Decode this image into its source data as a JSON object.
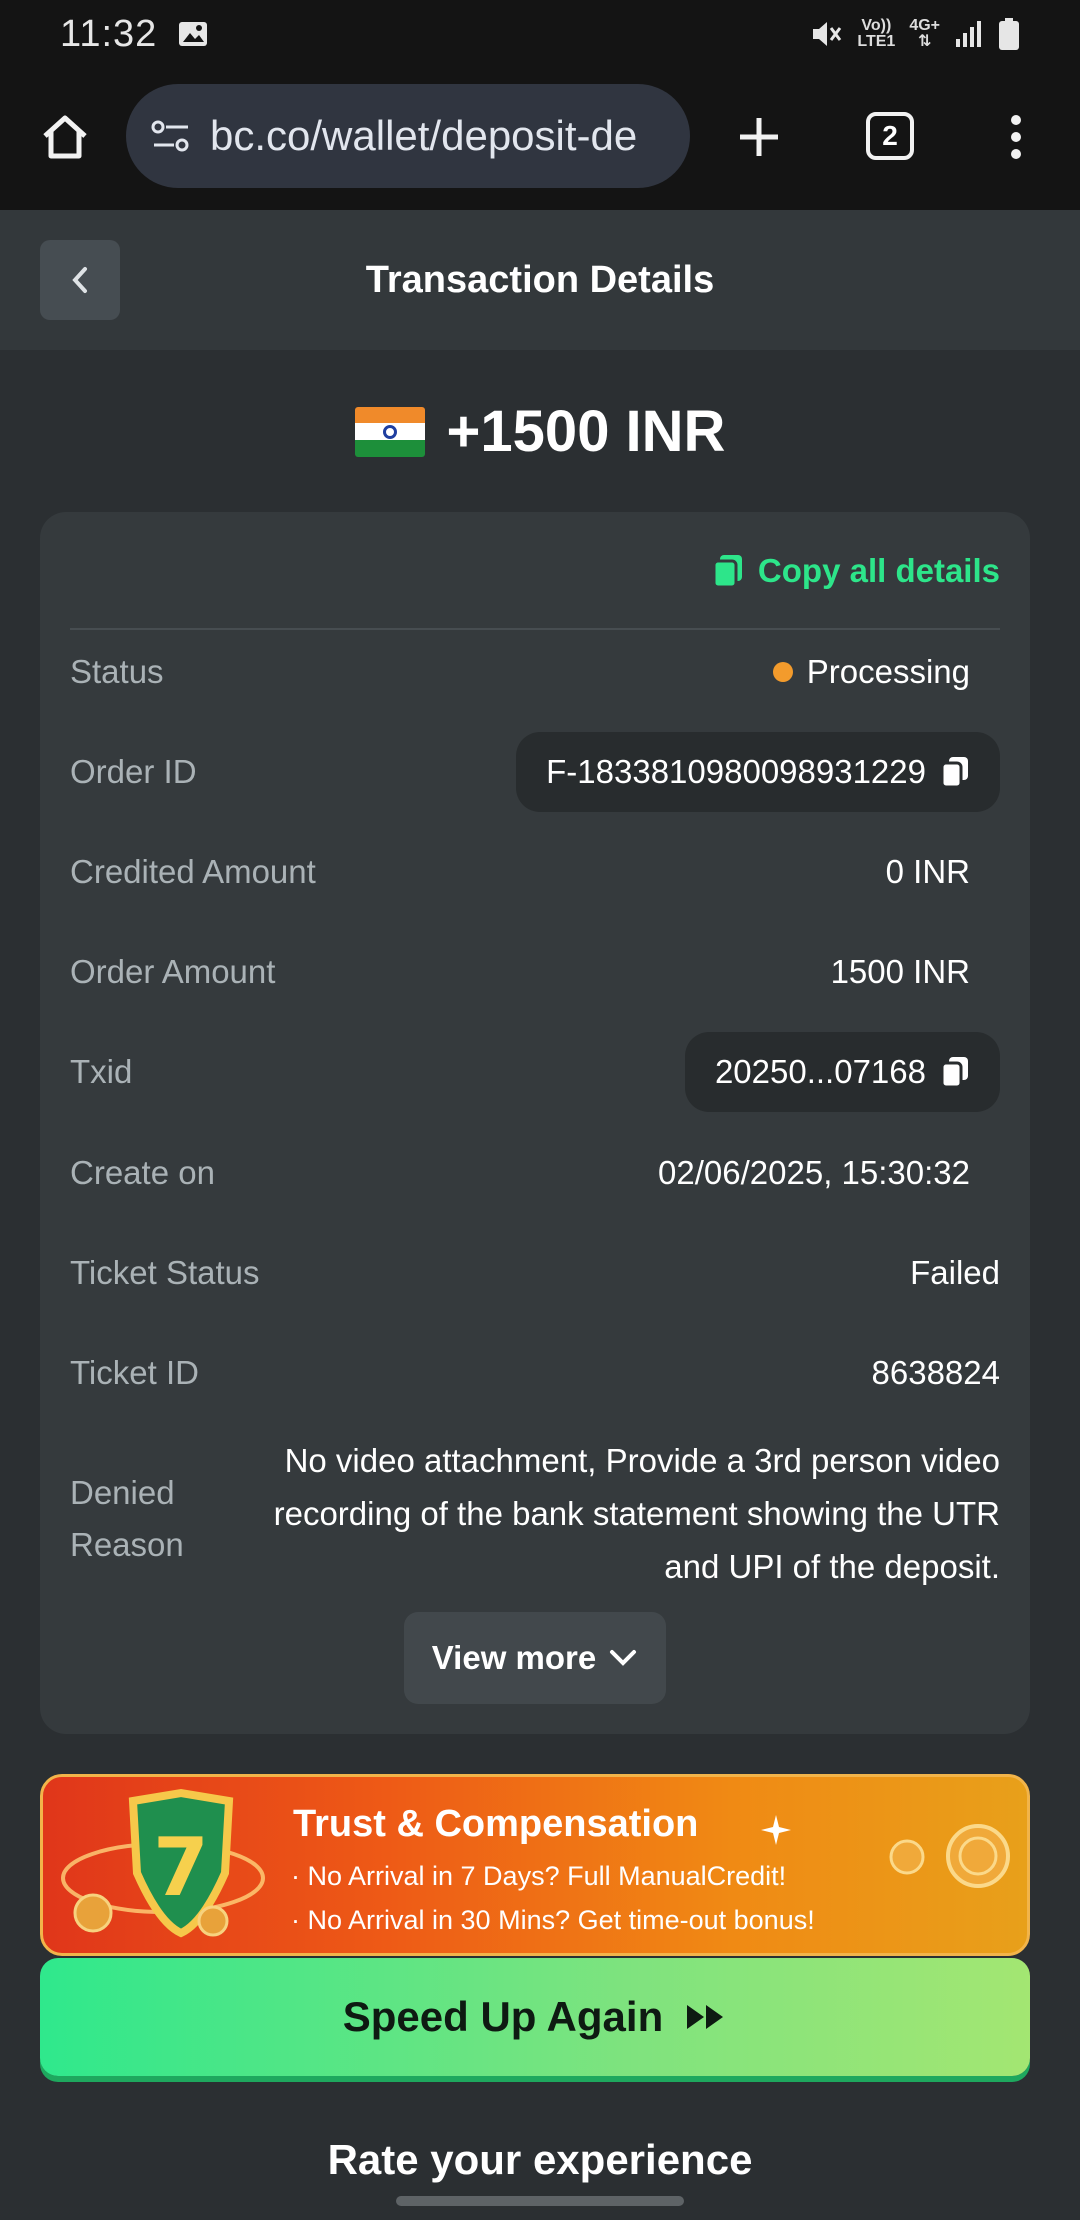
{
  "status_bar": {
    "time": "11:32",
    "volte": "Vo))",
    "lte": "LTE1",
    "network": "4G+"
  },
  "browser": {
    "url": "bc.co/wallet/deposit-de",
    "tab_count": "2"
  },
  "header": {
    "title": "Transaction Details"
  },
  "amount": {
    "text": "+1500 INR",
    "flag": "india-flag"
  },
  "card": {
    "copy_all": "Copy all details",
    "rows": [
      {
        "label": "Status",
        "value": "Processing"
      },
      {
        "label": "Order ID",
        "value": "F-1833810980098931229"
      },
      {
        "label": "Credited Amount",
        "value": "0 INR"
      },
      {
        "label": "Order Amount",
        "value": "1500 INR"
      },
      {
        "label": "Txid",
        "value": "20250...07168"
      },
      {
        "label": "Create on",
        "value": "02/06/2025, 15:30:32"
      },
      {
        "label": "Ticket Status",
        "value": "Failed"
      },
      {
        "label": "Ticket ID",
        "value": "8638824"
      }
    ],
    "denied_label_1": "Denied",
    "denied_label_2": "Reason",
    "denied_reason": "No video attachment, Provide a 3rd person video recording of the bank statement showing the UTR and UPI of the deposit.",
    "view_more": "View more"
  },
  "banner": {
    "title": "Trust & Compensation",
    "line1": "· No Arrival in 7 Days? Full ManualCredit!",
    "line2": "· No Arrival in 30 Mins? Get time-out bonus!",
    "badge_number": "7"
  },
  "speed_up": "Speed Up Again",
  "rate": "Rate your experience",
  "colors": {
    "accent_green": "#2de58a",
    "status_dot": "#f39b2c"
  }
}
